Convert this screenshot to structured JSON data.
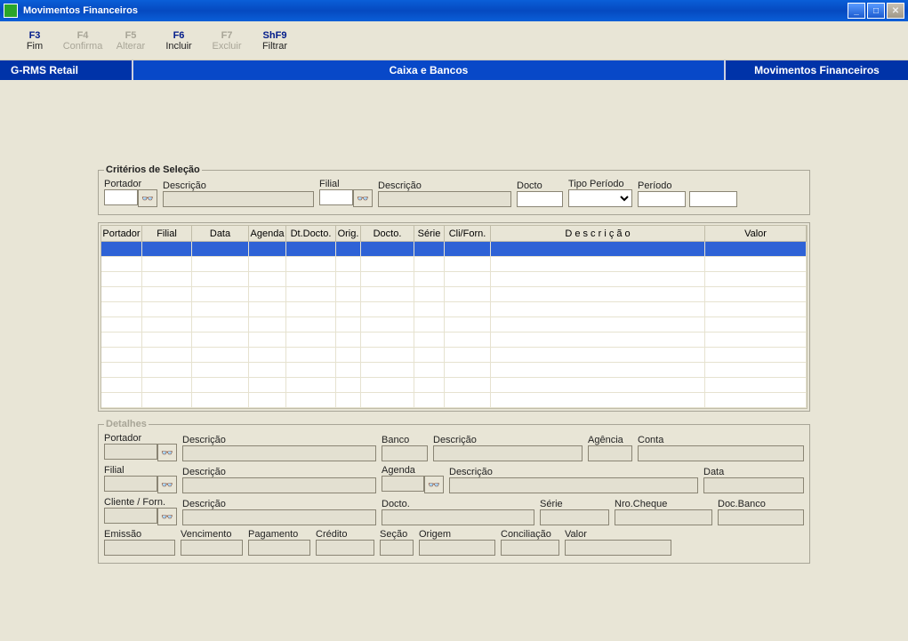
{
  "window": {
    "title": "Movimentos Financeiros"
  },
  "menu": {
    "f3": {
      "key": "F3",
      "label": "Fim",
      "enabled": true
    },
    "f4": {
      "key": "F4",
      "label": "Confirma",
      "enabled": false
    },
    "f5": {
      "key": "F5",
      "label": "Alterar",
      "enabled": false
    },
    "f6": {
      "key": "F6",
      "label": "Incluir",
      "enabled": true
    },
    "f7": {
      "key": "F7",
      "label": "Excluir",
      "enabled": false
    },
    "shf9": {
      "key": "ShF9",
      "label": "Filtrar",
      "enabled": true
    }
  },
  "breadcrumb": {
    "left": "G-RMS Retail",
    "center": "Caixa e Bancos",
    "right": "Movimentos Financeiros"
  },
  "selection": {
    "legend": "Critérios de Seleção",
    "portador": {
      "label": "Portador",
      "value": ""
    },
    "descricao1": {
      "label": "Descrição",
      "value": ""
    },
    "filial": {
      "label": "Filial",
      "value": ""
    },
    "descricao2": {
      "label": "Descrição",
      "value": ""
    },
    "docto": {
      "label": "Docto",
      "value": ""
    },
    "tipo_periodo": {
      "label": "Tipo Período",
      "value": ""
    },
    "periodo": {
      "label": "Período",
      "value": ""
    }
  },
  "grid": {
    "columns": [
      "Portador",
      "Filial",
      "Data",
      "Agenda",
      "Dt.Docto.",
      "Orig.",
      "Docto.",
      "Série",
      "Cli/Forn.",
      "D e s c r i ç ã o",
      "Valor"
    ]
  },
  "details": {
    "legend": "Detalhes",
    "portador": {
      "label": "Portador",
      "value": ""
    },
    "portador_desc": {
      "label": "Descrição",
      "value": ""
    },
    "banco": {
      "label": "Banco",
      "value": ""
    },
    "banco_desc": {
      "label": "Descrição",
      "value": ""
    },
    "agencia": {
      "label": "Agência",
      "value": ""
    },
    "conta": {
      "label": "Conta",
      "value": ""
    },
    "filial": {
      "label": "Filial",
      "value": ""
    },
    "filial_desc": {
      "label": "Descrição",
      "value": ""
    },
    "agenda": {
      "label": "Agenda",
      "value": ""
    },
    "agenda_desc": {
      "label": "Descrição",
      "value": ""
    },
    "data": {
      "label": "Data",
      "value": ""
    },
    "cliente": {
      "label": "Cliente / Forn.",
      "value": ""
    },
    "cliente_desc": {
      "label": "Descrição",
      "value": ""
    },
    "docto": {
      "label": "Docto.",
      "value": ""
    },
    "serie": {
      "label": "Série",
      "value": ""
    },
    "nrocheque": {
      "label": "Nro.Cheque",
      "value": ""
    },
    "docbanco": {
      "label": "Doc.Banco",
      "value": ""
    },
    "emissao": {
      "label": "Emissão",
      "value": ""
    },
    "vencimento": {
      "label": "Vencimento",
      "value": ""
    },
    "pagamento": {
      "label": "Pagamento",
      "value": ""
    },
    "credito": {
      "label": "Crédito",
      "value": ""
    },
    "secao": {
      "label": "Seção",
      "value": ""
    },
    "origem": {
      "label": "Origem",
      "value": ""
    },
    "conciliacao": {
      "label": "Conciliação",
      "value": ""
    },
    "valor": {
      "label": "Valor",
      "value": ""
    }
  }
}
